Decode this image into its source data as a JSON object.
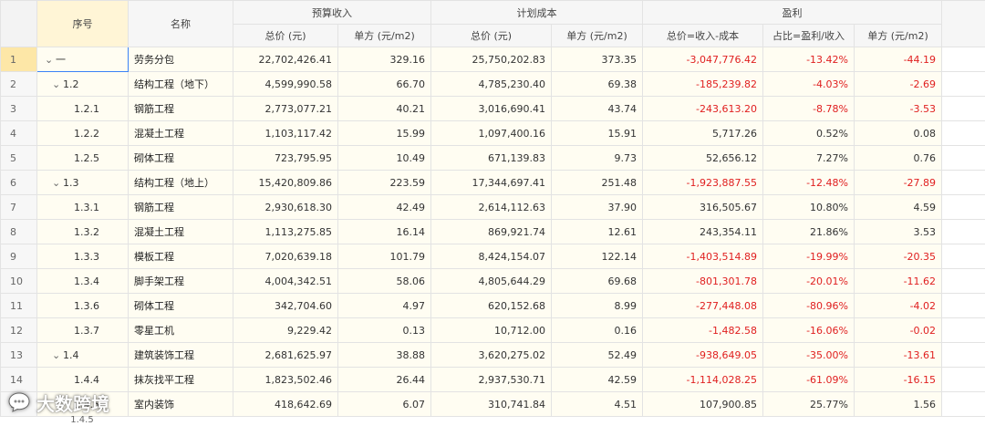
{
  "columns": {
    "xuhao": "序号",
    "name": "名称",
    "budget_group": "预算收入",
    "cost_group": "计划成本",
    "profit_group": "盈利",
    "total_price": "总价 (元)",
    "unit_price": "单方 (元/m2)",
    "profit_total": "总价=收入-成本",
    "profit_ratio": "占比=盈利/收入",
    "profit_unit": "单方 (元/m2)"
  },
  "rows": [
    {
      "idx": "1",
      "code": "一",
      "name": "劳务分包",
      "caret": "⌄",
      "level": 0,
      "b_total": "22,702,426.41",
      "b_unit": "329.16",
      "c_total": "25,750,202.83",
      "c_unit": "373.35",
      "p_total": "-3,047,776.42",
      "p_ratio": "-13.42%",
      "p_unit": "-44.19",
      "neg": true
    },
    {
      "idx": "2",
      "code": "1.2",
      "name": "结构工程（地下）",
      "caret": "⌄",
      "level": 1,
      "b_total": "4,599,990.58",
      "b_unit": "66.70",
      "c_total": "4,785,230.40",
      "c_unit": "69.38",
      "p_total": "-185,239.82",
      "p_ratio": "-4.03%",
      "p_unit": "-2.69",
      "neg": true
    },
    {
      "idx": "3",
      "code": "1.2.1",
      "name": "钢筋工程",
      "caret": "",
      "level": 2,
      "b_total": "2,773,077.21",
      "b_unit": "40.21",
      "c_total": "3,016,690.41",
      "c_unit": "43.74",
      "p_total": "-243,613.20",
      "p_ratio": "-8.78%",
      "p_unit": "-3.53",
      "neg": true
    },
    {
      "idx": "4",
      "code": "1.2.2",
      "name": "混凝土工程",
      "caret": "",
      "level": 2,
      "b_total": "1,103,117.42",
      "b_unit": "15.99",
      "c_total": "1,097,400.16",
      "c_unit": "15.91",
      "p_total": "5,717.26",
      "p_ratio": "0.52%",
      "p_unit": "0.08",
      "neg": false
    },
    {
      "idx": "5",
      "code": "1.2.5",
      "name": "砌体工程",
      "caret": "",
      "level": 2,
      "b_total": "723,795.95",
      "b_unit": "10.49",
      "c_total": "671,139.83",
      "c_unit": "9.73",
      "p_total": "52,656.12",
      "p_ratio": "7.27%",
      "p_unit": "0.76",
      "neg": false
    },
    {
      "idx": "6",
      "code": "1.3",
      "name": "结构工程（地上）",
      "caret": "⌄",
      "level": 1,
      "b_total": "15,420,809.86",
      "b_unit": "223.59",
      "c_total": "17,344,697.41",
      "c_unit": "251.48",
      "p_total": "-1,923,887.55",
      "p_ratio": "-12.48%",
      "p_unit": "-27.89",
      "neg": true
    },
    {
      "idx": "7",
      "code": "1.3.1",
      "name": "钢筋工程",
      "caret": "",
      "level": 2,
      "b_total": "2,930,618.30",
      "b_unit": "42.49",
      "c_total": "2,614,112.63",
      "c_unit": "37.90",
      "p_total": "316,505.67",
      "p_ratio": "10.80%",
      "p_unit": "4.59",
      "neg": false
    },
    {
      "idx": "8",
      "code": "1.3.2",
      "name": "混凝土工程",
      "caret": "",
      "level": 2,
      "b_total": "1,113,275.85",
      "b_unit": "16.14",
      "c_total": "869,921.74",
      "c_unit": "12.61",
      "p_total": "243,354.11",
      "p_ratio": "21.86%",
      "p_unit": "3.53",
      "neg": false
    },
    {
      "idx": "9",
      "code": "1.3.3",
      "name": "模板工程",
      "caret": "",
      "level": 2,
      "b_total": "7,020,639.18",
      "b_unit": "101.79",
      "c_total": "8,424,154.07",
      "c_unit": "122.14",
      "p_total": "-1,403,514.89",
      "p_ratio": "-19.99%",
      "p_unit": "-20.35",
      "neg": true
    },
    {
      "idx": "10",
      "code": "1.3.4",
      "name": "脚手架工程",
      "caret": "",
      "level": 2,
      "b_total": "4,004,342.51",
      "b_unit": "58.06",
      "c_total": "4,805,644.29",
      "c_unit": "69.68",
      "p_total": "-801,301.78",
      "p_ratio": "-20.01%",
      "p_unit": "-11.62",
      "neg": true
    },
    {
      "idx": "11",
      "code": "1.3.6",
      "name": "砌体工程",
      "caret": "",
      "level": 2,
      "b_total": "342,704.60",
      "b_unit": "4.97",
      "c_total": "620,152.68",
      "c_unit": "8.99",
      "p_total": "-277,448.08",
      "p_ratio": "-80.96%",
      "p_unit": "-4.02",
      "neg": true
    },
    {
      "idx": "12",
      "code": "1.3.7",
      "name": "零星工机",
      "caret": "",
      "level": 2,
      "b_total": "9,229.42",
      "b_unit": "0.13",
      "c_total": "10,712.00",
      "c_unit": "0.16",
      "p_total": "-1,482.58",
      "p_ratio": "-16.06%",
      "p_unit": "-0.02",
      "neg": true
    },
    {
      "idx": "13",
      "code": "1.4",
      "name": "建筑装饰工程",
      "caret": "⌄",
      "level": 1,
      "b_total": "2,681,625.97",
      "b_unit": "38.88",
      "c_total": "3,620,275.02",
      "c_unit": "52.49",
      "p_total": "-938,649.05",
      "p_ratio": "-35.00%",
      "p_unit": "-13.61",
      "neg": true
    },
    {
      "idx": "14",
      "code": "1.4.4",
      "name": "抹灰找平工程",
      "caret": "",
      "level": 2,
      "b_total": "1,823,502.46",
      "b_unit": "26.44",
      "c_total": "2,937,530.71",
      "c_unit": "42.59",
      "p_total": "-1,114,028.25",
      "p_ratio": "-61.09%",
      "p_unit": "-16.15",
      "neg": true
    },
    {
      "idx": "15",
      "code": "1.4.5",
      "name": "室内装饰",
      "caret": "",
      "level": 2,
      "b_total": "418,642.69",
      "b_unit": "6.07",
      "c_total": "310,741.84",
      "c_unit": "4.51",
      "p_total": "107,900.85",
      "p_ratio": "25.77%",
      "p_unit": "1.56",
      "neg": false
    }
  ],
  "partial_row_code": "1.4.5",
  "watermark_text": "大数跨境",
  "colors": {
    "negative": "#e02020",
    "row_bg": "#fffdf2",
    "selection": "#3b82f6"
  }
}
